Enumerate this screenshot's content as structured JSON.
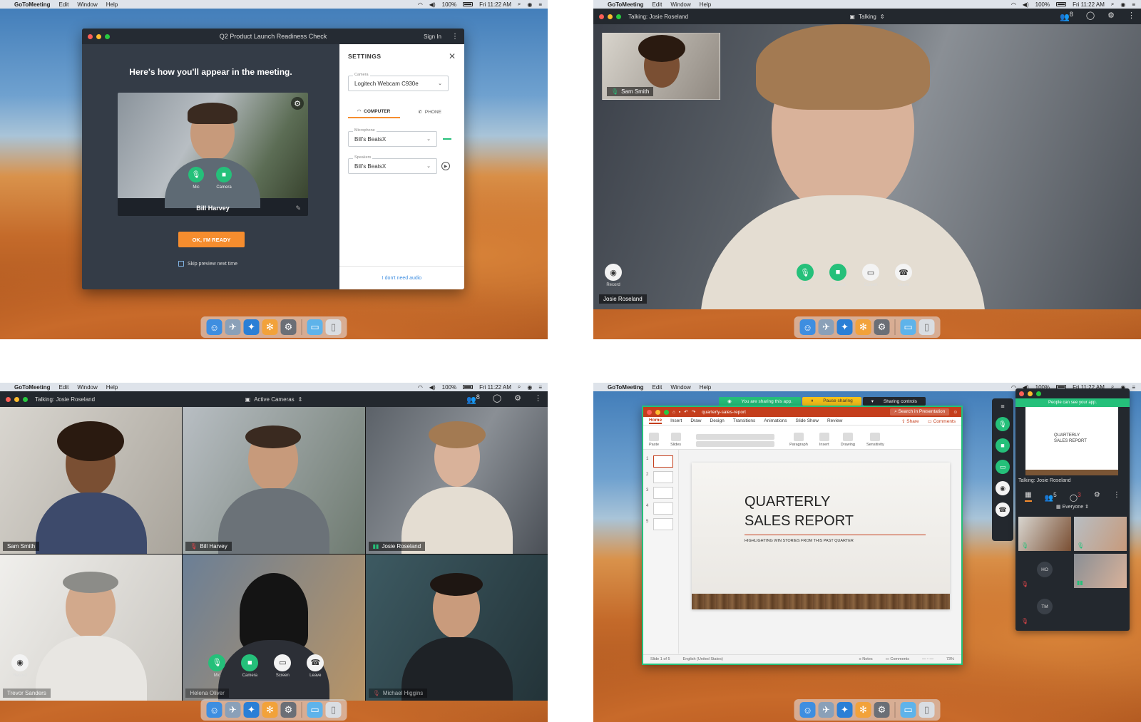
{
  "menubar": {
    "app": "GoToMeeting",
    "items": [
      "Edit",
      "Window",
      "Help"
    ],
    "battery": "100%",
    "clock": "Fri 11:22 AM"
  },
  "panel1": {
    "window_title": "Q2 Product Launch Readiness Check",
    "sign_in": "Sign In",
    "heading": "Here's how you'll appear in the meeting.",
    "participant_name": "Bill Harvey",
    "mic_label": "Mic",
    "camera_label": "Camera",
    "ready_button": "OK, I'M READY",
    "skip_label": "Skip preview next time",
    "settings": {
      "title": "SETTINGS",
      "camera_label": "Camera",
      "camera_value": "Logitech Webcam C930e",
      "tab_computer": "COMPUTER",
      "tab_phone": "PHONE",
      "microphone_label": "Microphone",
      "microphone_value": "Bill's BeatsX",
      "speakers_label": "Speakers",
      "speakers_value": "Bill's BeatsX",
      "no_audio_link": "I don't need audio"
    }
  },
  "panel2": {
    "talking": "Talking: Josie Roseland",
    "view_mode": "Talking",
    "attendee_count": "8",
    "thumb_name": "Sam Smith",
    "speaker_name": "Josie Roseland",
    "controls": [
      "Record",
      "Mic",
      "Camera",
      "Screen",
      "Leave"
    ]
  },
  "panel3": {
    "talking": "Talking: Josie Roseland",
    "view_mode": "Active Cameras",
    "attendee_count": "8",
    "participants": [
      "Sam Smith",
      "Bill Harvey",
      "Josie Roseland",
      "Trevor Sanders",
      "Helena Oliver",
      "Michael Higgins"
    ],
    "controls": [
      "Record",
      "Mic",
      "Camera",
      "Screen",
      "Leave"
    ]
  },
  "panel4": {
    "sharing_notice": "You are sharing this app.",
    "pause_sharing": "Pause sharing",
    "sharing_controls": "Sharing controls",
    "file_name": "quarterly-sales-report",
    "search_placeholder": "Search in Presentation",
    "ribbon_tabs": [
      "Home",
      "Insert",
      "Draw",
      "Design",
      "Transitions",
      "Animations",
      "Slide Show",
      "Review"
    ],
    "share_btn": "Share",
    "comments_btn": "Comments",
    "ribbon_groups": [
      "Paste",
      "Slides",
      "Paragraph",
      "Insert",
      "Drawing",
      "Sensitivity"
    ],
    "slide_numbers": [
      "1",
      "2",
      "3",
      "4",
      "5"
    ],
    "slide_title_line1": "QUARTERLY",
    "slide_title_line2": "SALES REPORT",
    "slide_subtitle": "HIGHLIGHTING WIN STORIES FROM THIS PAST QUARTER",
    "status_slide": "Slide 1 of 5",
    "status_lang": "English (United States)",
    "status_notes": "Notes",
    "status_comments": "Comments",
    "status_zoom": "73%",
    "mini_banner": "People can see your app.",
    "mini_preview_line1": "QUARTERLY",
    "mini_preview_line2": "SALES REPORT",
    "mini_talking": "Talking: Josie Roseland",
    "attendee_count": "5",
    "chat_count": "3",
    "audience": "Everyone",
    "initials": [
      "HO",
      "TM"
    ]
  },
  "colors": {
    "accent_green": "#25c07a",
    "orange": "#f68d2e",
    "ppt_red": "#c43e1c",
    "dark_chrome": "#23282e"
  }
}
